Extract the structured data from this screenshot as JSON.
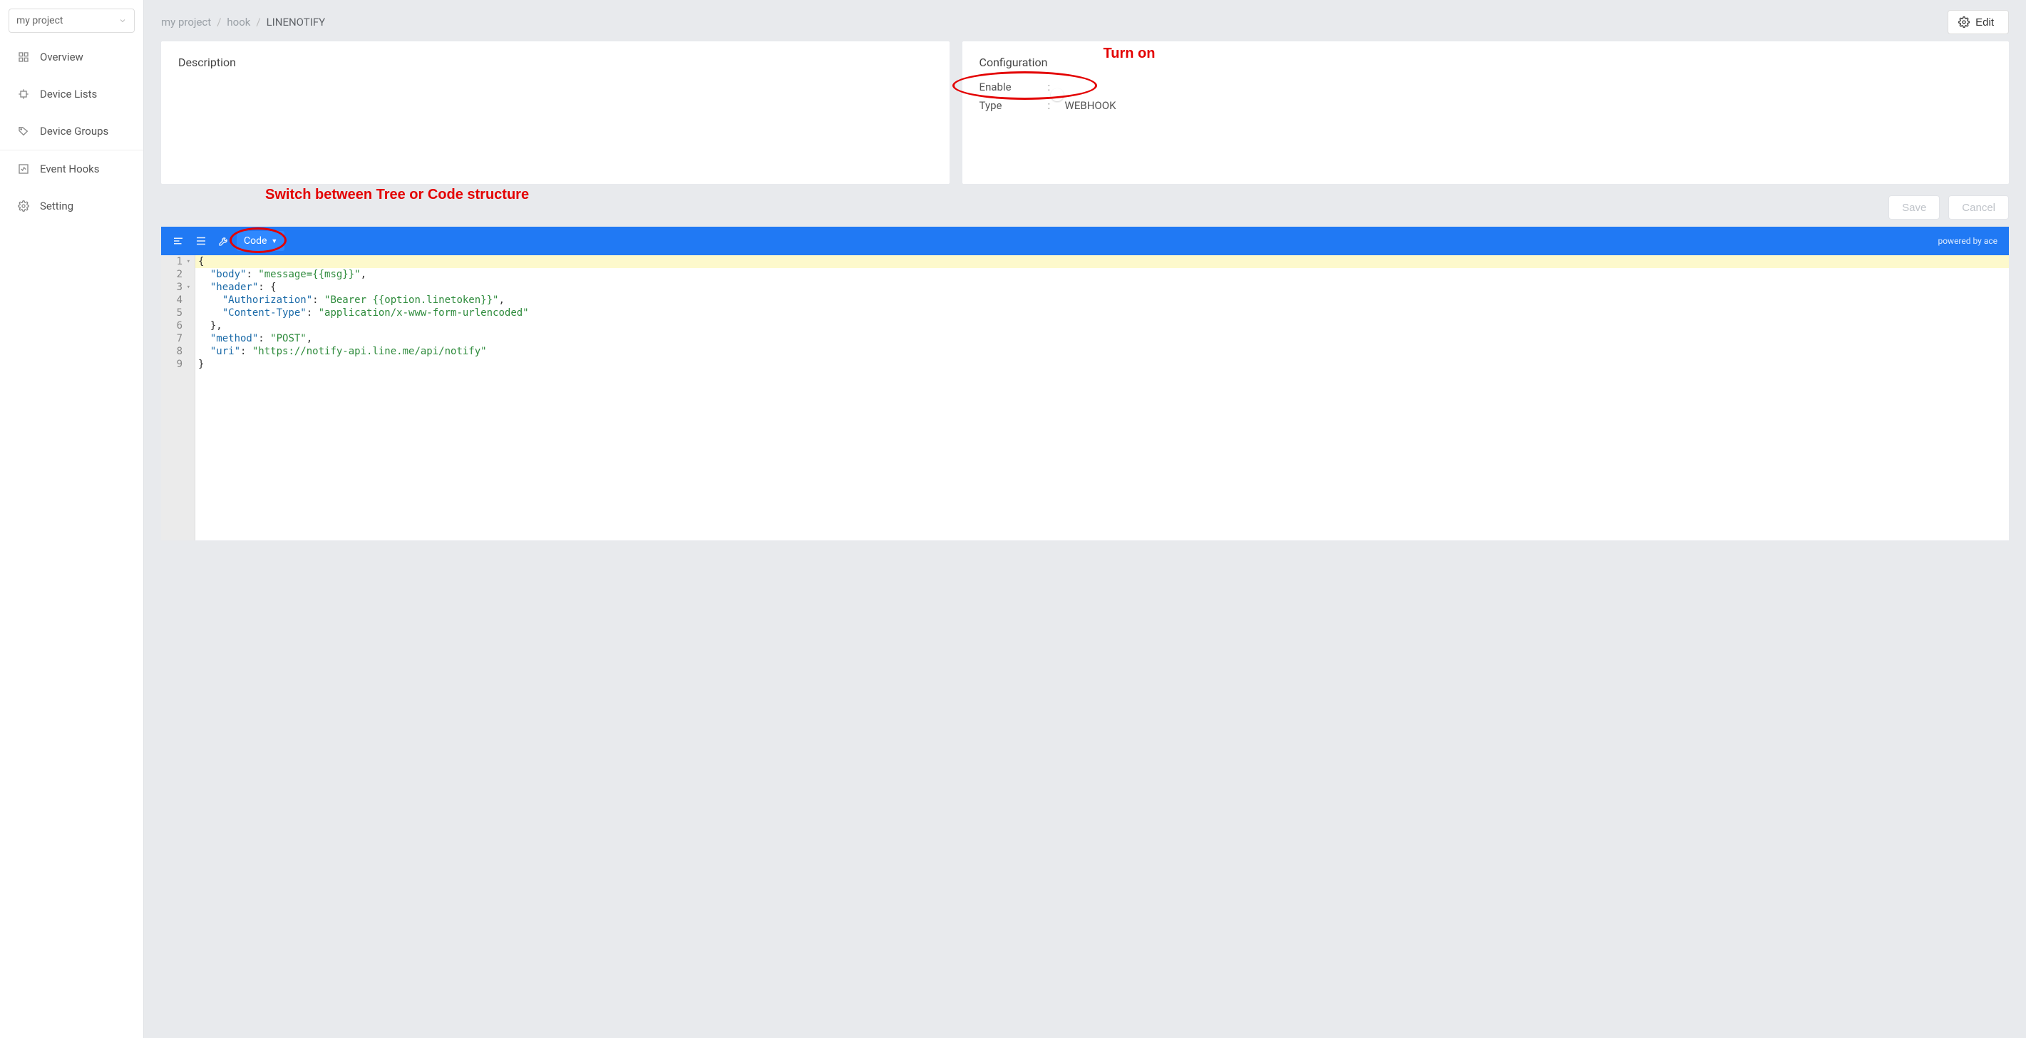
{
  "project_selector": {
    "label": "my project"
  },
  "sidebar": {
    "items": [
      {
        "label": "Overview"
      },
      {
        "label": "Device Lists"
      },
      {
        "label": "Device Groups"
      },
      {
        "label": "Event Hooks"
      },
      {
        "label": "Setting"
      }
    ]
  },
  "breadcrumb": {
    "a": "my project",
    "b": "hook",
    "c": "LINENOTIFY"
  },
  "edit_button": {
    "label": "Edit"
  },
  "description_card": {
    "title": "Description"
  },
  "config_card": {
    "title": "Configuration",
    "rows": {
      "enable_key": "Enable",
      "type_key": "Type",
      "type_value": "WEBHOOK"
    }
  },
  "actions": {
    "save": "Save",
    "cancel": "Cancel"
  },
  "editor": {
    "mode_label": "Code",
    "powered_by": "powered by ace"
  },
  "annotations": {
    "turn_on": "Turn on",
    "switch_mode": "Switch between Tree or Code structure"
  },
  "code": {
    "lines": [
      {
        "n": "1",
        "fold": true,
        "indent": "",
        "segments": [
          {
            "t": "hl",
            "v": "{"
          }
        ]
      },
      {
        "n": "2",
        "fold": false,
        "indent": "  ",
        "segments": [
          {
            "t": "key",
            "v": "\"body\""
          },
          {
            "t": "punc",
            "v": ": "
          },
          {
            "t": "str",
            "v": "\"message={{msg}}\""
          },
          {
            "t": "punc",
            "v": ","
          }
        ]
      },
      {
        "n": "3",
        "fold": true,
        "indent": "  ",
        "segments": [
          {
            "t": "key",
            "v": "\"header\""
          },
          {
            "t": "punc",
            "v": ": {"
          }
        ]
      },
      {
        "n": "4",
        "fold": false,
        "indent": "    ",
        "segments": [
          {
            "t": "key",
            "v": "\"Authorization\""
          },
          {
            "t": "punc",
            "v": ": "
          },
          {
            "t": "str",
            "v": "\"Bearer {{option.linetoken}}\""
          },
          {
            "t": "punc",
            "v": ","
          }
        ]
      },
      {
        "n": "5",
        "fold": false,
        "indent": "    ",
        "segments": [
          {
            "t": "key",
            "v": "\"Content-Type\""
          },
          {
            "t": "punc",
            "v": ": "
          },
          {
            "t": "str",
            "v": "\"application/x-www-form-urlencoded\""
          }
        ]
      },
      {
        "n": "6",
        "fold": false,
        "indent": "  ",
        "segments": [
          {
            "t": "punc",
            "v": "},"
          }
        ]
      },
      {
        "n": "7",
        "fold": false,
        "indent": "  ",
        "segments": [
          {
            "t": "key",
            "v": "\"method\""
          },
          {
            "t": "punc",
            "v": ": "
          },
          {
            "t": "str",
            "v": "\"POST\""
          },
          {
            "t": "punc",
            "v": ","
          }
        ]
      },
      {
        "n": "8",
        "fold": false,
        "indent": "  ",
        "segments": [
          {
            "t": "key",
            "v": "\"uri\""
          },
          {
            "t": "punc",
            "v": ": "
          },
          {
            "t": "str",
            "v": "\"https://notify-api.line.me/api/notify\""
          }
        ]
      },
      {
        "n": "9",
        "fold": false,
        "indent": "",
        "segments": [
          {
            "t": "punc",
            "v": "}"
          }
        ]
      }
    ]
  }
}
